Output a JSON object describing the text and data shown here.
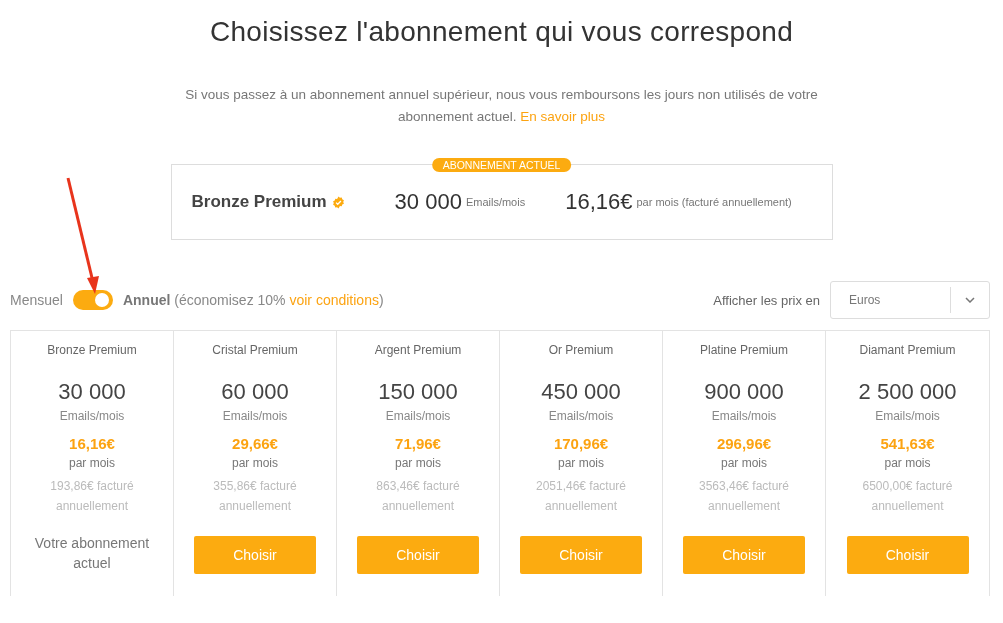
{
  "title": "Choisissez l'abonnement qui vous correspond",
  "intro": {
    "text": "Si vous passez à un abonnement annuel supérieur, nous vous remboursons les jours non utilisés de votre abonnement actuel.",
    "link": "En savoir plus"
  },
  "current_plan": {
    "badge": "ABONNEMENT ACTUEL",
    "name": "Bronze Premium",
    "emails": "30 000",
    "emails_unit": "Emails/mois",
    "price": "16,16€",
    "price_unit": "par mois (facturé annuellement)"
  },
  "billing": {
    "left_label": "Mensuel",
    "on": true,
    "right_text": "**Annuel** (économisez 10% ",
    "link": "voir conditions",
    "right_end": ")"
  },
  "currency": {
    "label": "Afficher les prix en",
    "value": "Euros"
  },
  "plans": [
    {
      "name": "Bronze Premium",
      "emails": "30 000",
      "unit": "Emails/mois",
      "price": "16,16€",
      "period": "par mois",
      "billed": "193,86€ facturé annuellement",
      "current": true,
      "action": "Votre abonnement actuel"
    },
    {
      "name": "Cristal Premium",
      "emails": "60 000",
      "unit": "Emails/mois",
      "price": "29,66€",
      "period": "par mois",
      "billed": "355,86€ facturé annuellement",
      "current": false,
      "action": "Choisir"
    },
    {
      "name": "Argent Premium",
      "emails": "150 000",
      "unit": "Emails/mois",
      "price": "71,96€",
      "period": "par mois",
      "billed": "863,46€ facturé annuellement",
      "current": false,
      "action": "Choisir"
    },
    {
      "name": "Or Premium",
      "emails": "450 000",
      "unit": "Emails/mois",
      "price": "170,96€",
      "period": "par mois",
      "billed": "2051,46€ facturé annuellement",
      "current": false,
      "action": "Choisir"
    },
    {
      "name": "Platine Premium",
      "emails": "900 000",
      "unit": "Emails/mois",
      "price": "296,96€",
      "period": "par mois",
      "billed": "3563,46€ facturé annuellement",
      "current": false,
      "action": "Choisir"
    },
    {
      "name": "Diamant Premium",
      "emails": "2 500 000",
      "unit": "Emails/mois",
      "price": "541,63€",
      "period": "par mois",
      "billed": "6500,00€ facturé annuellement",
      "current": false,
      "action": "Choisir"
    }
  ]
}
